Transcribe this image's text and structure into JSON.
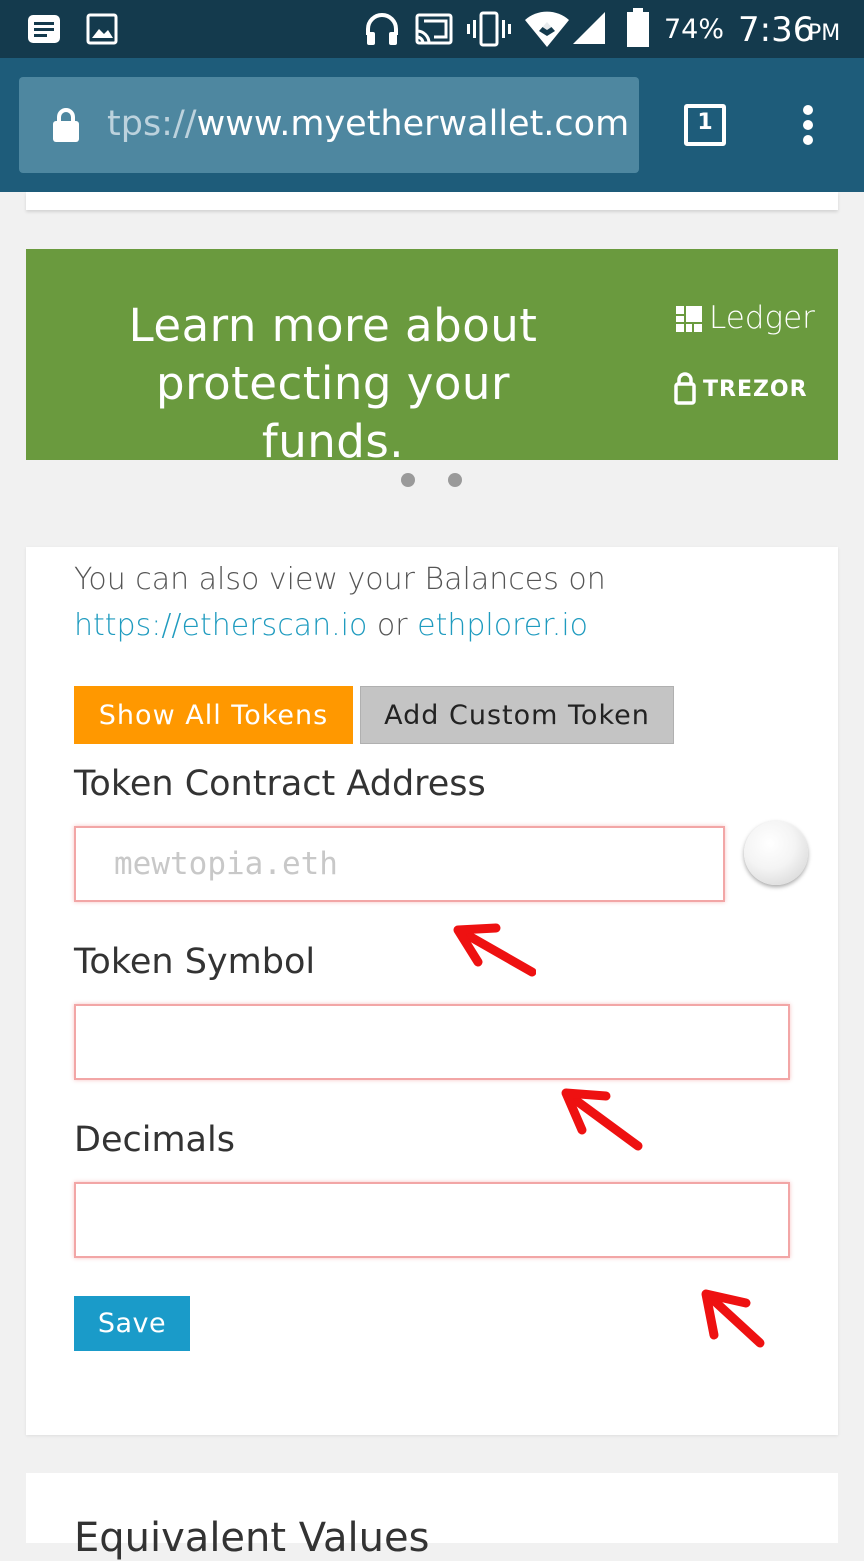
{
  "status_bar": {
    "battery": "74%",
    "time": "7:36",
    "ampm": "PM",
    "icons": [
      "notification-icon",
      "image-icon",
      "headphones-icon",
      "cast-icon",
      "vibrate-icon",
      "wifi-icon",
      "signal-icon",
      "battery-icon"
    ]
  },
  "browser": {
    "url_faded": "tps://",
    "url_main": "www.myetherwallet.com",
    "tab_count": "1",
    "icons": [
      "lock-icon",
      "tabs-icon",
      "menu-icon"
    ]
  },
  "banner": {
    "line1": "Learn more about",
    "line2": "protecting your funds.",
    "ledger": "Ledger",
    "trezor": "TREZOR",
    "background": "#6a9a3e"
  },
  "balances": {
    "prefix": "You can also view your Balances on",
    "link1": "https://etherscan.io",
    "or": "or",
    "link2": "ethplorer.io"
  },
  "buttons": {
    "show_all": "Show All Tokens",
    "add_custom": "Add Custom Token",
    "save": "Save"
  },
  "form": {
    "address_label": "Token Contract Address",
    "address_placeholder": "mewtopia.eth",
    "address_value": "",
    "symbol_label": "Token Symbol",
    "symbol_value": "",
    "decimals_label": "Decimals",
    "decimals_value": ""
  },
  "next_section": {
    "heading": "Equivalent Values"
  },
  "colors": {
    "accent_orange": "#ff9800",
    "link_blue": "#1f9bbf",
    "save_blue": "#1a9bc9",
    "annotation_red": "#ee1111"
  }
}
